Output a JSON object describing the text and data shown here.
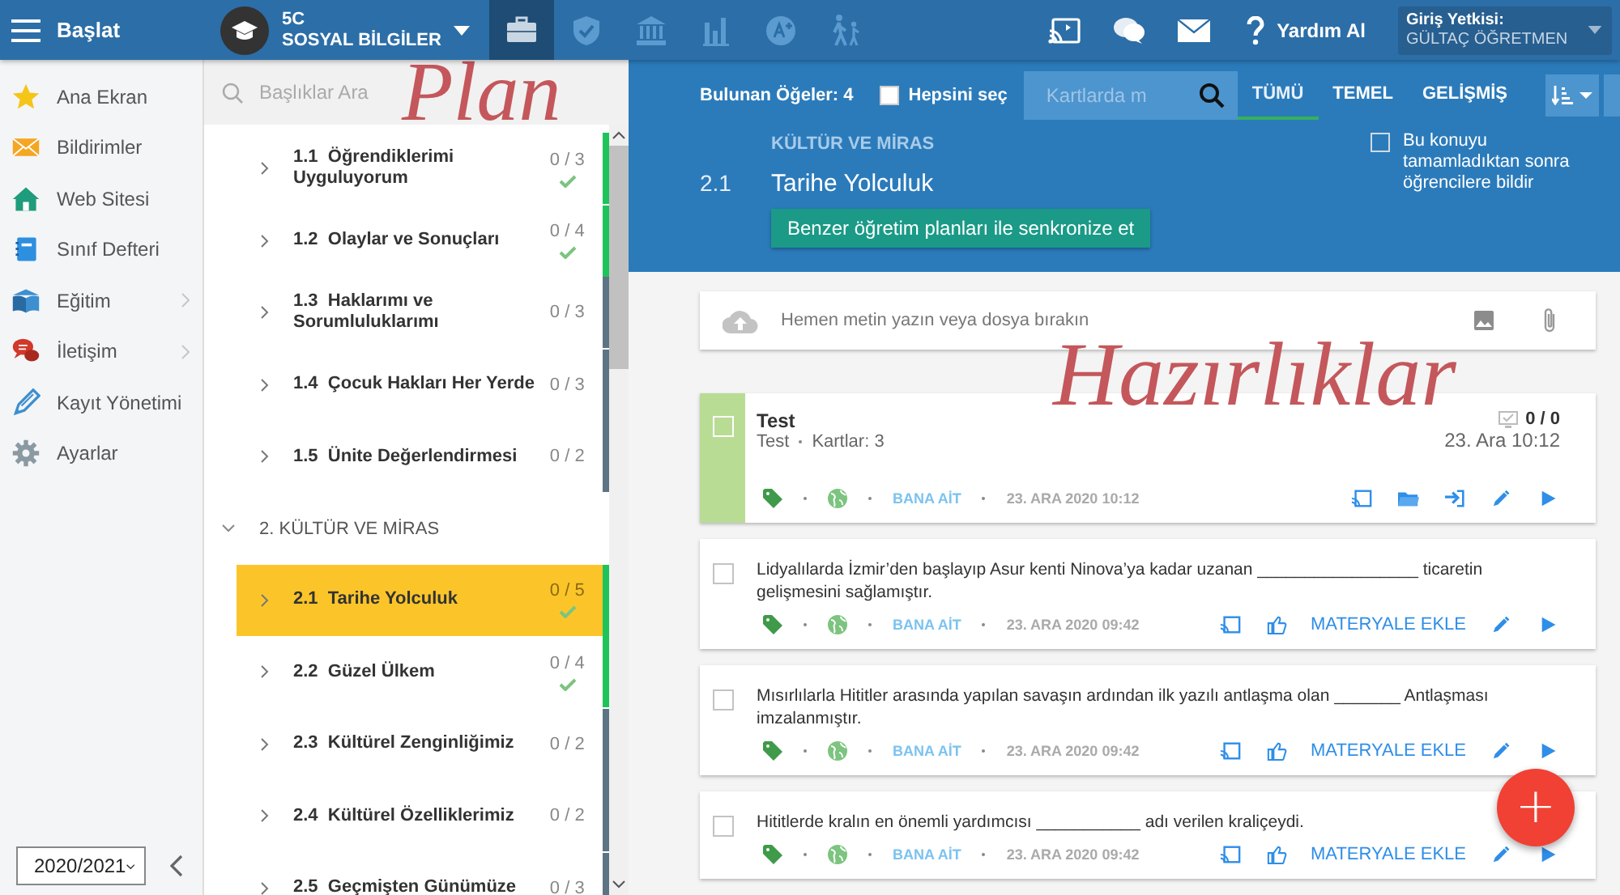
{
  "topbar": {
    "menu_label": "Başlat",
    "course": {
      "code": "5C",
      "name": "SOSYAL BİLGİLER"
    },
    "nav_tabs": [
      {
        "selected": true
      },
      {
        "selected": false
      },
      {
        "selected": false
      },
      {
        "selected": false
      },
      {
        "selected": false
      },
      {
        "selected": false
      }
    ],
    "help": "Yardım Al",
    "login": {
      "label": "Giriş Yetkisi:",
      "user": "GÜLTAÇ ÖĞRETMEN"
    }
  },
  "sidebar": {
    "items": [
      {
        "label": "Ana Ekran",
        "has_submenu": false
      },
      {
        "label": "Bildirimler",
        "has_submenu": false
      },
      {
        "label": "Web Sitesi",
        "has_submenu": false
      },
      {
        "label": "Sınıf Defteri",
        "has_submenu": false
      },
      {
        "label": "Eğitim",
        "has_submenu": true
      },
      {
        "label": "İletişim",
        "has_submenu": true
      },
      {
        "label": "Kayıt Yönetimi",
        "has_submenu": false
      },
      {
        "label": "Ayarlar",
        "has_submenu": false
      }
    ],
    "year": "2020/2021"
  },
  "plan": {
    "search": {
      "placeholder": "Başlıklar Ara"
    },
    "items": [
      {
        "kind": "lesson",
        "number": "1.1",
        "title": "Öğrendiklerimi Uyguluyorum",
        "count": "0 / 3",
        "completed": true,
        "selected": false
      },
      {
        "kind": "lesson",
        "number": "1.2",
        "title": "Olaylar ve Sonuçları",
        "count": "0 / 4",
        "completed": true,
        "selected": false
      },
      {
        "kind": "lesson",
        "number": "1.3",
        "title": "Haklarımı ve Sorumluluklarımı",
        "count": "0 / 3",
        "completed": false,
        "selected": false
      },
      {
        "kind": "lesson",
        "number": "1.4",
        "title": "Çocuk Hakları Her Yerde",
        "count": "0 / 3",
        "completed": false,
        "selected": false
      },
      {
        "kind": "lesson",
        "number": "1.5",
        "title": "Ünite Değerlendirmesi",
        "count": "0 / 2",
        "completed": false,
        "selected": false
      },
      {
        "kind": "unit",
        "title": "2. KÜLTÜR VE MİRAS",
        "expanded": true,
        "children": [
          {
            "kind": "lesson",
            "number": "2.1",
            "title": "Tarihe Yolculuk",
            "count": "0 / 5",
            "completed": true,
            "selected": true
          },
          {
            "kind": "lesson",
            "number": "2.2",
            "title": "Güzel Ülkem",
            "count": "0 / 4",
            "completed": true,
            "selected": false
          },
          {
            "kind": "lesson",
            "number": "2.3",
            "title": "Kültürel Zenginliğimiz",
            "count": "0 / 2",
            "completed": false,
            "selected": false
          },
          {
            "kind": "lesson",
            "number": "2.4",
            "title": "Kültürel Özelliklerimiz",
            "count": "0 / 2",
            "completed": false,
            "selected": false
          },
          {
            "kind": "lesson",
            "number": "2.5",
            "title": "Geçmişten Günümüze",
            "count": "0 / 3",
            "completed": false,
            "selected": false
          }
        ]
      }
    ]
  },
  "toolbar": {
    "found": "Bulunan Öğeler: 4",
    "select_all": {
      "label": "Hepsini seç",
      "checked": false
    },
    "search": {
      "placeholder": "Kartlarda m"
    },
    "filters": [
      {
        "label": "TÜMÜ",
        "selected": true
      },
      {
        "label": "TEMEL",
        "selected": false
      },
      {
        "label": "GELİŞMİŞ",
        "selected": false
      }
    ]
  },
  "topic": {
    "number": "2.1",
    "unit": "KÜLTÜR VE MİRAS",
    "title": "Tarihe Yolculuk",
    "sync_button": "Benzer öğretim planları ile senkronize et",
    "notify": {
      "label": "Bu konuyu tamamladıktan sonra öğrencilere bildir",
      "checked": false
    }
  },
  "upload": {
    "placeholder": "Hemen metin yazın veya dosya bırakın"
  },
  "cards": [
    {
      "kind": "test",
      "title": "Test",
      "type": "Test",
      "meta": "Kartlar: 3",
      "score": "0 / 0",
      "time": "23. Ara 10:12",
      "owner": "BANA AİT",
      "date": "23. ARA 2020 10:12",
      "checked": false
    },
    {
      "kind": "question",
      "text": "Lidyalılarda İzmir’den başlayıp Asur kenti Ninova’ya kadar uzanan _________________ ticaretin gelişmesini sağlamıştır.",
      "owner": "BANA AİT",
      "date": "23. ARA 2020 09:42",
      "action": "MATERYALE EKLE",
      "checked": false
    },
    {
      "kind": "question",
      "text": "Mısırlılarla Hititler arasında yapılan savaşın ardından ilk yazılı antlaşma olan _______ Antlaşması imzalanmıştır.",
      "owner": "BANA AİT",
      "date": "23. ARA 2020 09:42",
      "action": "MATERYALE EKLE",
      "checked": false
    },
    {
      "kind": "question",
      "text": "Hititlerde kralın en önemli yardımcısı ___________  adı verilen kraliçeydi.",
      "owner": "BANA AİT",
      "date": "23. ARA 2020 09:42",
      "action": "MATERYALE EKLE",
      "checked": false
    }
  ],
  "fab": "+",
  "annotations": [
    {
      "text": "Plan"
    },
    {
      "text": "Hazırlıklar"
    }
  ]
}
